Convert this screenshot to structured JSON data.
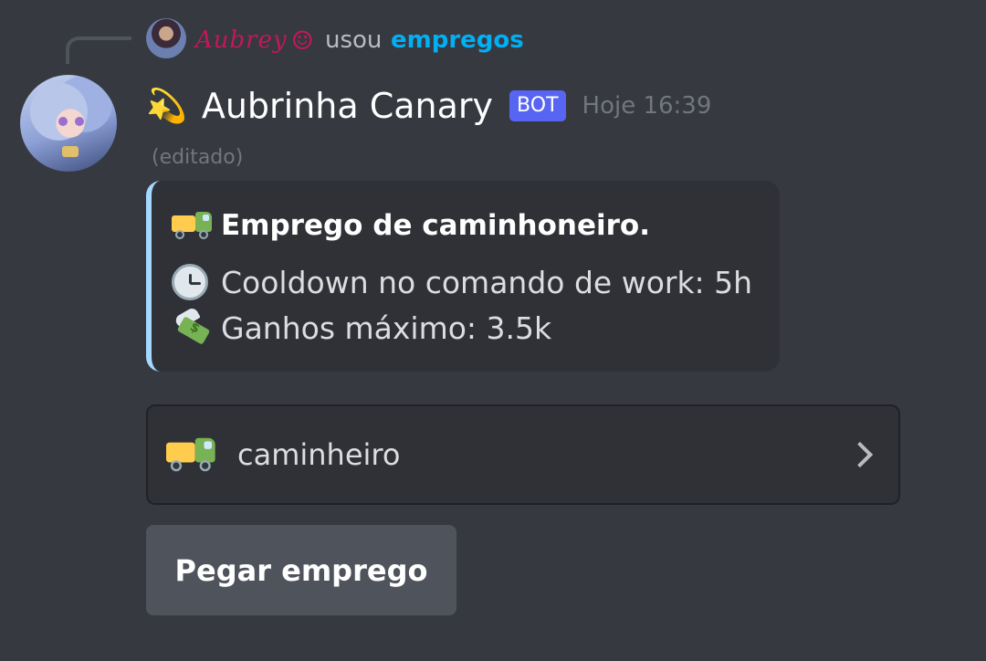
{
  "reply": {
    "user_name": "Aubrey",
    "decoration": "☺",
    "action_text": "usou",
    "command": "empregos"
  },
  "message": {
    "emoji": "💫",
    "author": "Aubrinha Canary",
    "bot_tag": "BOT",
    "timestamp": "Hoje 16:39",
    "edited_label": "(editado)"
  },
  "embed": {
    "accent_color": "#a5d8ff",
    "title_icon": "truck-icon",
    "title": "Emprego de caminhoneiro.",
    "fields": [
      {
        "icon": "clock-icon",
        "text": "Cooldown no comando de work: 5h"
      },
      {
        "icon": "money-with-wings-icon",
        "text": "Ganhos máximo: 3.5k"
      }
    ]
  },
  "select_menu": {
    "icon": "truck-icon",
    "selected_value": "caminheiro"
  },
  "button": {
    "label": "Pegar emprego"
  },
  "colors": {
    "background": "#36393f",
    "embed_background": "#2f3136",
    "bot_tag": "#5865f2",
    "command_link": "#00aff4",
    "reply_username": "#c2185b",
    "button": "#4f545c"
  }
}
